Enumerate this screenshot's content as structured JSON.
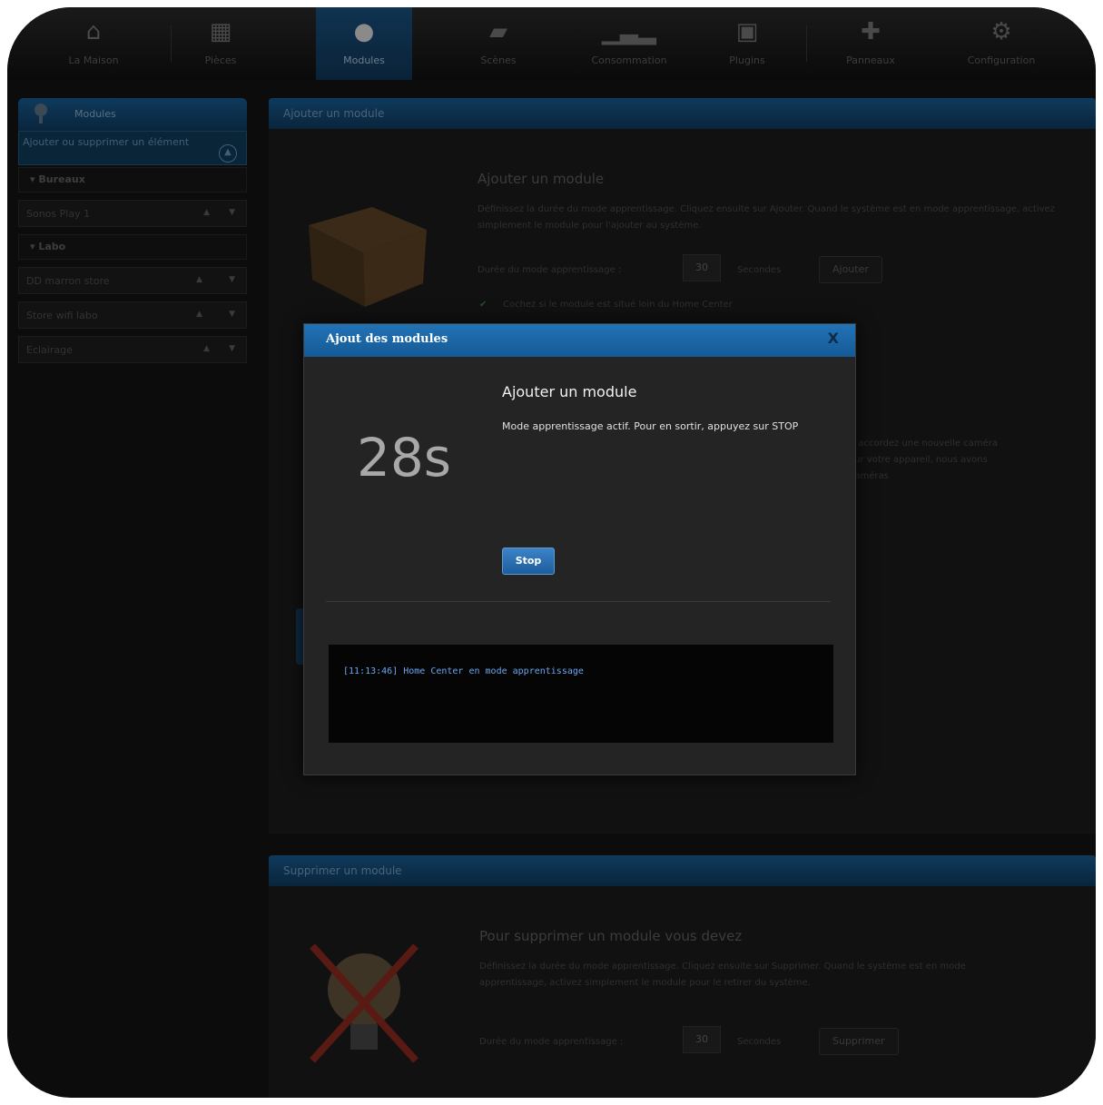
{
  "nav": {
    "items": [
      {
        "label": "La Maison",
        "icon": "house-icon"
      },
      {
        "label": "Pièces",
        "icon": "rooms-icon"
      },
      {
        "label": "Modules",
        "icon": "bulb-icon",
        "active": true
      },
      {
        "label": "Scènes",
        "icon": "clapper-icon"
      },
      {
        "label": "Consommation",
        "icon": "chart-icon"
      },
      {
        "label": "Plugins",
        "icon": "gift-icon"
      },
      {
        "label": "Panneaux",
        "icon": "puzzle-icon"
      },
      {
        "label": "Configuration",
        "icon": "gears-icon"
      }
    ]
  },
  "sidebar": {
    "title": "Modules",
    "subtitle": "Ajouter ou supprimer un élément",
    "groups": [
      {
        "label": "Bureaux",
        "items": [
          {
            "label": "Sonos Play 1"
          }
        ]
      },
      {
        "label": "Labo",
        "items": [
          {
            "label": "DD marron store"
          },
          {
            "label": "Store wifi labo"
          },
          {
            "label": "Eclairage"
          }
        ]
      }
    ]
  },
  "add_panel": {
    "header": "Ajouter un module",
    "title": "Ajouter un module",
    "description": "Définissez la durée du mode apprentissage. Cliquez ensuite sur Ajouter. Quand le système est en mode apprentissage, activez simplement le module pour l'ajouter au système.",
    "duration_label": "Durée du mode apprentissage :",
    "duration_value": "30",
    "seconds_label": "Secondes",
    "add_button": "Ajouter",
    "checkbox_label": "Cochez si le module est situé loin du Home Center",
    "partial_text": "é accordez une nouvelle caméra\nsur votre appareil, nous avons\ncaméras"
  },
  "remove_panel": {
    "header": "Supprimer un module",
    "title": "Pour supprimer un module vous devez",
    "description": "Définissez la durée du mode apprentissage. Cliquez ensuite sur Supprimer. Quand le système est en mode apprentissage, activez simplement le module pour le retirer du système.",
    "duration_label": "Durée du mode apprentissage :",
    "duration_value": "30",
    "seconds_label": "Secondes",
    "remove_button": "Supprimer"
  },
  "modal": {
    "title": "Ajout des modules",
    "close": "X",
    "countdown": "28s",
    "heading": "Ajouter un module",
    "message": "Mode apprentissage actif. Pour en sortir, appuyez sur STOP",
    "stop_button": "Stop",
    "log_line": "[11:13:46] Home Center en mode apprentissage"
  }
}
